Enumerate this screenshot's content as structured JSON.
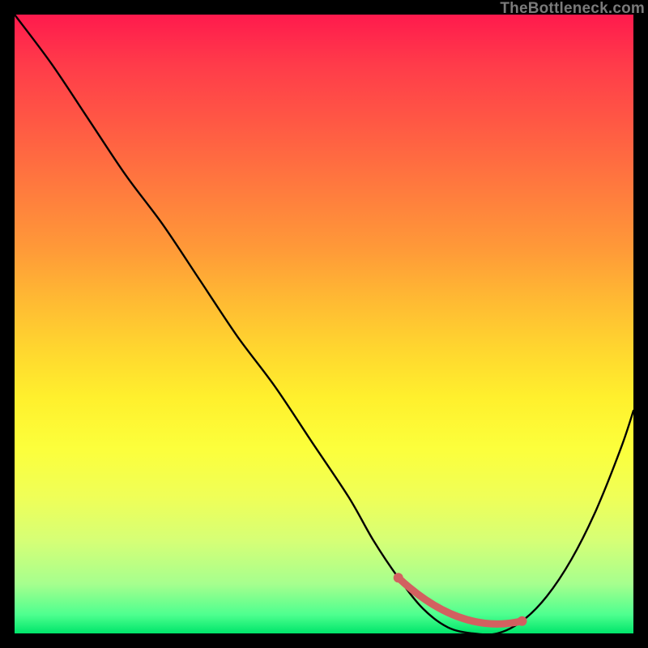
{
  "watermark": "TheBottleneck.com",
  "chart_data": {
    "type": "line",
    "title": "",
    "xlabel": "",
    "ylabel": "",
    "xlim": [
      0,
      100
    ],
    "ylim": [
      0,
      100
    ],
    "series": [
      {
        "name": "bottleneck-curve",
        "x": [
          0,
          6,
          12,
          18,
          24,
          30,
          36,
          42,
          48,
          54,
          58,
          62,
          66,
          70,
          74,
          78,
          82,
          86,
          90,
          94,
          98,
          100
        ],
        "y": [
          100,
          92,
          83,
          74,
          66,
          57,
          48,
          40,
          31,
          22,
          15,
          9,
          4,
          1,
          0,
          0,
          2,
          6,
          12,
          20,
          30,
          36
        ]
      }
    ],
    "markers": [
      {
        "name": "optimal-range-start",
        "x": 62,
        "y": 9
      },
      {
        "name": "optimal-range-end",
        "x": 82,
        "y": 2
      }
    ],
    "background_gradient": {
      "top": "#ff1a4d",
      "mid": "#fff02d",
      "bottom": "#00e56a"
    }
  }
}
